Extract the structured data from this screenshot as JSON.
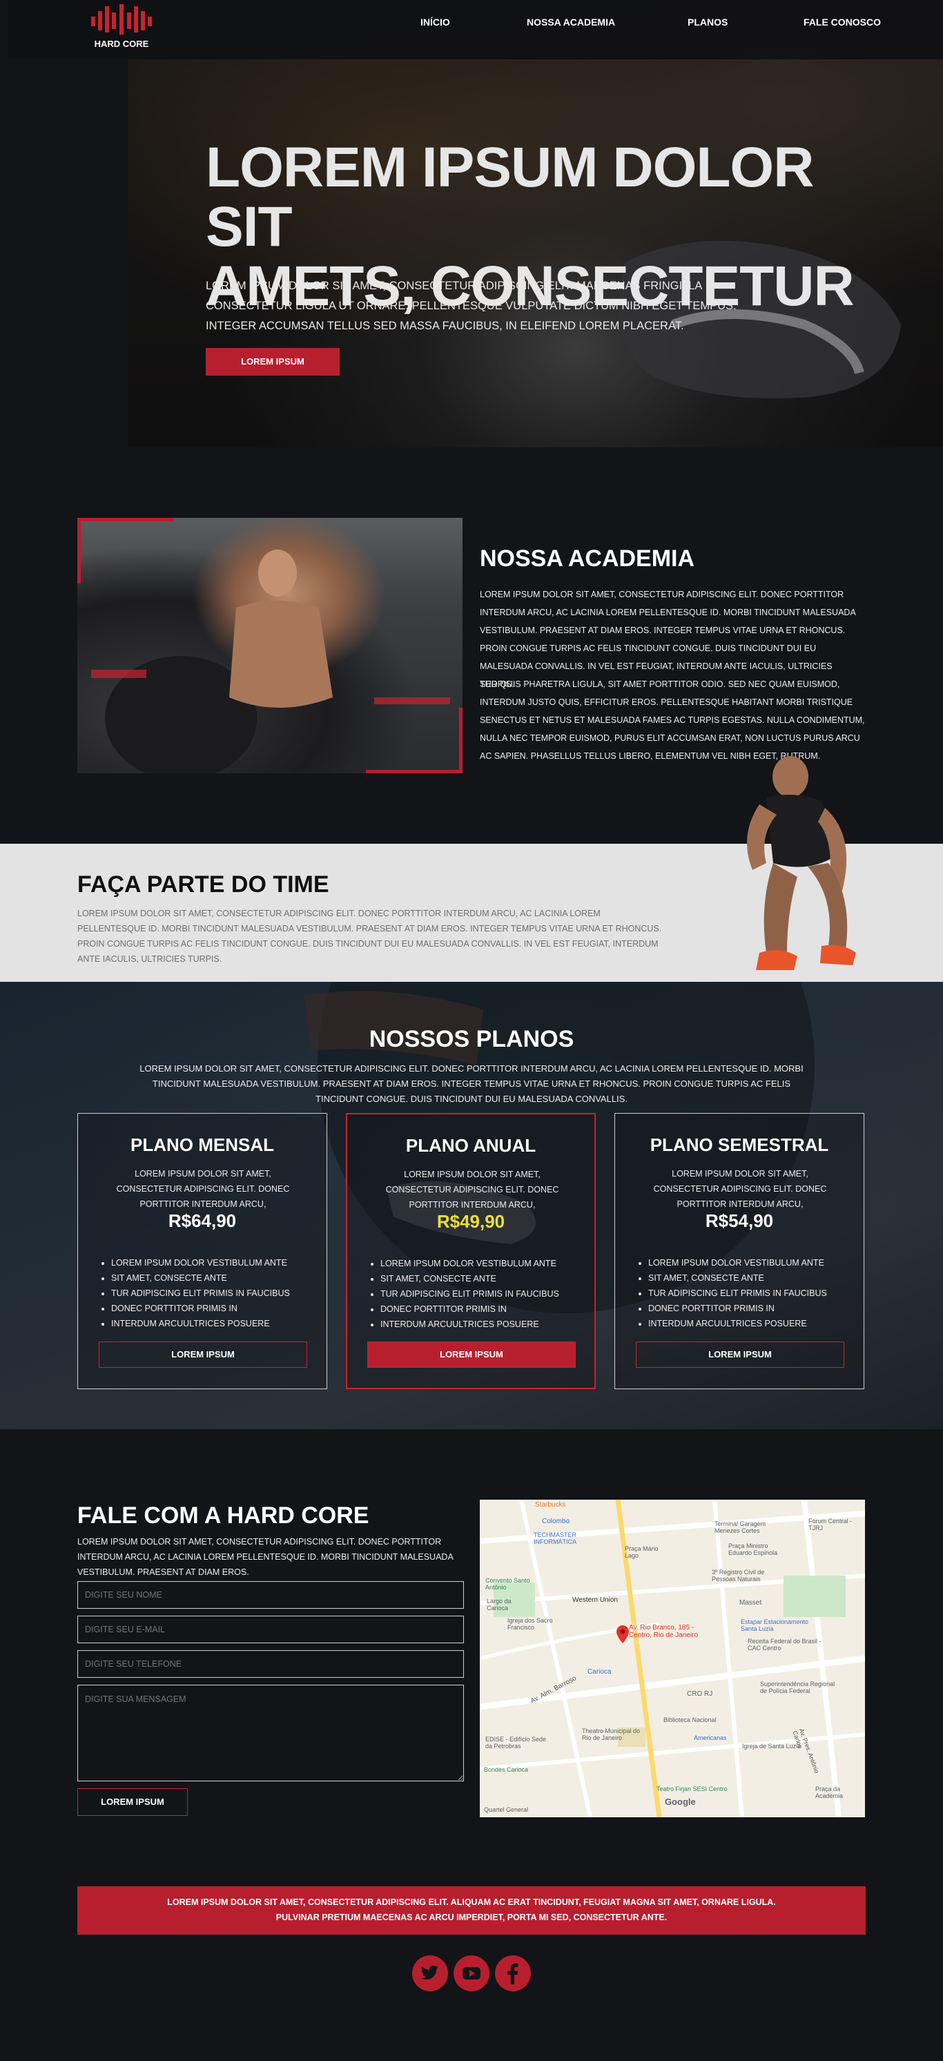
{
  "nav": {
    "brand": "HARD CORE",
    "links": [
      "INÍCIO",
      "NOSSA ACADEMIA",
      "PLANOS",
      "FALE CONOSCO"
    ]
  },
  "hero": {
    "title_line1": "LOREM IPSUM DOLOR SIT",
    "title_line2": "AMETS, CONSECTETUR",
    "text": "LOREM IPSUM DOLOR SIT AMET, CONSECTETUR ADIPISCING ELIT. MAECENAS FRINGILLA CONSECTETUR LIGULA UT ORNARE. PELLENTESQUE VULPUTATE DICTUM NIBH EGET TEMPUS. INTEGER ACCUMSAN TELLUS SED MASSA FAUCIBUS, IN ELEIFEND LOREM PLACERAT.",
    "button": "LOREM IPSUM"
  },
  "academia": {
    "title": "NOSSA ACADEMIA",
    "p1": "LOREM IPSUM DOLOR SIT AMET, CONSECTETUR ADIPISCING ELIT. DONEC PORTTITOR INTERDUM ARCU, AC LACINIA LOREM PELLENTESQUE ID. MORBI TINCIDUNT MALESUADA VESTIBULUM. PRAESENT AT DIAM EROS. INTEGER TEMPUS VITAE URNA ET RHONCUS. PROIN CONGUE TURPIS AC FELIS TINCIDUNT CONGUE. DUIS TINCIDUNT DUI EU MALESUADA CONVALLIS. IN VEL EST FEUGIAT, INTERDUM ANTE IACULIS, ULTRICIES TURPIS.",
    "p2": "SED QUIS PHARETRA LIGULA, SIT AMET PORTTITOR ODIO. SED NEC QUAM EUISMOD, INTERDUM JUSTO QUIS, EFFICITUR EROS. PELLENTESQUE HABITANT MORBI TRISTIQUE SENECTUS ET NETUS ET MALESUADA FAMES AC TURPIS EGESTAS. NULLA CONDIMENTUM, NULLA NEC TEMPOR EUISMOD, PURUS ELIT ACCUMSAN ERAT, NON LUCTUS PURUS ARCU AC SAPIEN. PHASELLUS TELLUS LIBERO, ELEMENTUM VEL NIBH EGET, RUTRUM."
  },
  "time": {
    "title": "FAÇA PARTE DO TIME",
    "text": "LOREM IPSUM DOLOR SIT AMET, CONSECTETUR ADIPISCING ELIT. DONEC PORTTITOR INTERDUM ARCU, AC LACINIA LOREM PELLENTESQUE ID. MORBI TINCIDUNT MALESUADA VESTIBULUM. PRAESENT AT DIAM EROS. INTEGER TEMPUS VITAE URNA ET RHONCUS. PROIN CONGUE TURPIS AC FELIS TINCIDUNT CONGUE. DUIS TINCIDUNT DUI EU MALESUADA CONVALLIS. IN VEL EST FEUGIAT, INTERDUM ANTE IACULIS, ULTRICIES TURPIS."
  },
  "plans": {
    "title": "NOSSOS PLANOS",
    "text": "LOREM IPSUM DOLOR SIT AMET, CONSECTETUR ADIPISCING ELIT. DONEC PORTTITOR INTERDUM ARCU, AC LACINIA LOREM PELLENTESQUE ID. MORBI TINCIDUNT MALESUADA VESTIBULUM. PRAESENT AT DIAM EROS. INTEGER TEMPUS VITAE URNA ET RHONCUS. PROIN CONGUE TURPIS AC FELIS TINCIDUNT CONGUE. DUIS TINCIDUNT DUI EU MALESUADA CONVALLIS.",
    "cards": [
      {
        "name": "PLANO MENSAL",
        "desc": "LOREM IPSUM DOLOR SIT AMET, CONSECTETUR ADIPISCING ELIT. DONEC PORTTITOR INTERDUM ARCU,",
        "price": "R$64,90",
        "button": "LOREM IPSUM",
        "items": [
          "LOREM IPSUM DOLOR VESTIBULUM ANTE",
          "SIT AMET, CONSECTE  ANTE",
          "TUR ADIPISCING ELIT  PRIMIS IN FAUCIBUS",
          "DONEC PORTTITOR  PRIMIS IN",
          "INTERDUM ARCUULTRICES POSUERE"
        ]
      },
      {
        "name": "PLANO ANUAL",
        "desc": "LOREM IPSUM DOLOR SIT AMET, CONSECTETUR ADIPISCING ELIT. DONEC PORTTITOR INTERDUM ARCU,",
        "price": "R$49,90",
        "button": "LOREM IPSUM",
        "items": [
          "LOREM IPSUM DOLOR VESTIBULUM ANTE",
          "SIT AMET, CONSECTE  ANTE",
          "TUR ADIPISCING ELIT  PRIMIS IN FAUCIBUS",
          "DONEC PORTTITOR  PRIMIS IN",
          "INTERDUM ARCUULTRICES POSUERE"
        ]
      },
      {
        "name": "PLANO SEMESTRAL",
        "desc": "LOREM IPSUM DOLOR SIT AMET, CONSECTETUR ADIPISCING ELIT. DONEC PORTTITOR INTERDUM ARCU,",
        "price": "R$54,90",
        "button": "LOREM IPSUM",
        "items": [
          "LOREM IPSUM DOLOR VESTIBULUM ANTE",
          "SIT AMET, CONSECTE  ANTE",
          "TUR ADIPISCING ELIT  PRIMIS IN FAUCIBUS",
          "DONEC PORTTITOR  PRIMIS IN",
          "INTERDUM ARCUULTRICES POSUERE"
        ]
      }
    ]
  },
  "contact": {
    "title": "FALE COM A HARD CORE",
    "text": "LOREM IPSUM DOLOR SIT AMET, CONSECTETUR ADIPISCING ELIT. DONEC PORTTITOR INTERDUM ARCU, AC LACINIA LOREM PELLENTESQUE ID. MORBI TINCIDUNT MALESUADA VESTIBULUM. PRAESENT AT DIAM EROS.",
    "ph_name": "DIGITE SEU NOME",
    "ph_email": "DIGITE SEU E-MAIL",
    "ph_phone": "DIGITE SEU TELEFONE",
    "ph_msg": "DIGITE SUA MENSAGEM",
    "button": "LOREM IPSUM"
  },
  "map": {
    "labels": [
      "Starbucks",
      "Colombo",
      "TECHMASTER INFORMÁTICA",
      "Terminal Garagem Menezes Cortes",
      "Fórum Central - TJRJ",
      "Praça Mário Lago",
      "Praça Ministro Eduardo Espinola",
      "3º Registro Civil de Pessoas Naturais",
      "Convento Santo Antônio",
      "Western Union",
      "Masset",
      "Largo da Carioca",
      "Av. Rio Branco, 185 - Centro, Rio de Janeiro",
      "Estapar Estacionamento Santa Luzia",
      "Igreja dos Sacro Francisco",
      "Receita Federal do Brasil - CAC Centro",
      "Carioca",
      "CRO RJ",
      "Av. Alm. Barroso",
      "Superintendência Regional de Polícia Federal",
      "Theatro Municipal do Rio de Janeiro",
      "Biblioteca Nacional",
      "Americanas",
      "Igreja de Santa Luzia",
      "EDISE - Edifício Sede da Petrobras",
      "Bondes Carioca",
      "Av. Pres. Antônio Carlos",
      "Teatro Firjan SESI Centro",
      "Praça da Academia",
      "Quartel General",
      "Google"
    ],
    "pin_color": "#e5322c"
  },
  "footer": {
    "line1": "LOREM IPSUM DOLOR SIT AMET, CONSECTETUR ADIPISCING ELIT. ALIQUAM AC ERAT TINCIDUNT, FEUGIAT MAGNA SIT AMET, ORNARE LIGULA.",
    "line2": "PULVINAR PRETIUM MAECENAS AC ARCU IMPERDIET, PORTA MI SED, CONSECTETUR ANTE.",
    "social": [
      "twitter-icon",
      "youtube-icon",
      "facebook-icon"
    ]
  },
  "colors": {
    "accent": "#b81f2e",
    "price_highlight": "#e8e03a",
    "bg": "#121418",
    "band": "#e3e3e3"
  }
}
